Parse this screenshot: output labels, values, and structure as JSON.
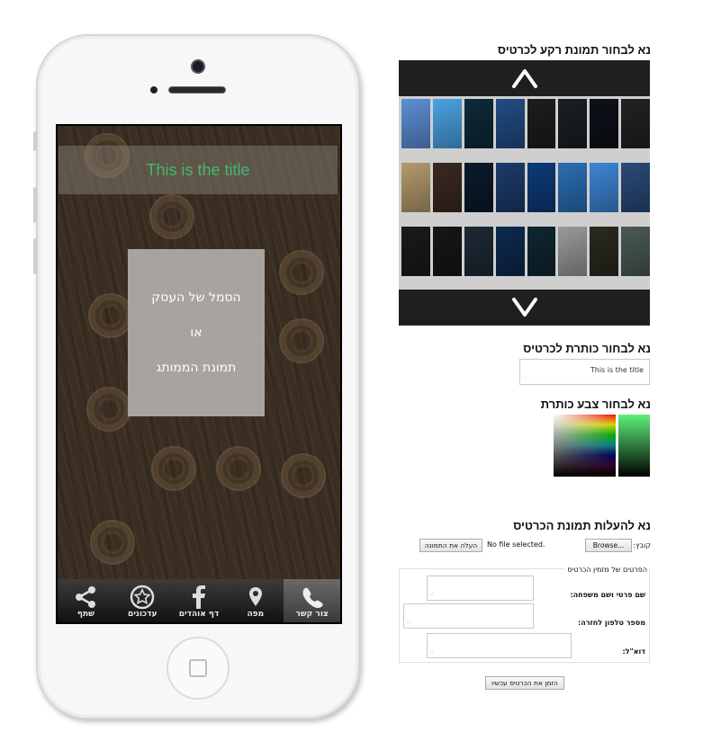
{
  "phone": {
    "card_title": "This is the title",
    "logo_lines": [
      "הסמל של העסק",
      "או",
      "תמונת הממותג"
    ],
    "tabs": [
      {
        "label": "צור קשר",
        "icon": "phone-icon",
        "active": true
      },
      {
        "label": "מפה",
        "icon": "map-pin-icon",
        "active": false
      },
      {
        "label": "דף אוהדים",
        "icon": "facebook-icon",
        "active": false
      },
      {
        "label": "עדכונים",
        "icon": "star-icon",
        "active": false
      },
      {
        "label": "שתף",
        "icon": "share-icon",
        "active": false
      }
    ],
    "title_color": "#42b96c"
  },
  "panel": {
    "bg_heading": "נא לבחור תמונת רקע לכרטיס",
    "title_heading": "נא לבחור כותרת לכרטיס",
    "title_value": "This is the title",
    "color_heading": "נא לבחור צבע כותרת",
    "upload_heading": "נא להעלות תמונת הכרטיס",
    "file_label": "קובץ:",
    "browse_label": "Browse...",
    "no_file_text": "No file selected.",
    "upload_button": "העלה את התמונה",
    "orderer_legend": "הפרטים של מזמין הכרטיס",
    "name_label": "שם פרטי ושם משפחה:",
    "phone_label": "מספר טלפון לחזרה:",
    "email_label": "דוא\"ל:",
    "order_button": "הזמן את הכרטיס עכשיו"
  },
  "swatches": [
    [
      "#5b8fd6",
      "#4aa3e3",
      "#0e2a3a",
      "#234c85",
      "#1d1d1d",
      "#1a1f24",
      "#0d1118",
      "#222222"
    ],
    [
      "#b49a6c",
      "#3a2a20",
      "#0b1a2a",
      "#1c3b6a",
      "#0d3a78",
      "#2a6fb3",
      "#3d86d4",
      "#2b4a78"
    ],
    [
      "#1a1a1a",
      "#161616",
      "#1e2a35",
      "#0d2a4d",
      "#102630",
      "#9a9a9a",
      "#2a2a20",
      "#4a5a55"
    ]
  ]
}
